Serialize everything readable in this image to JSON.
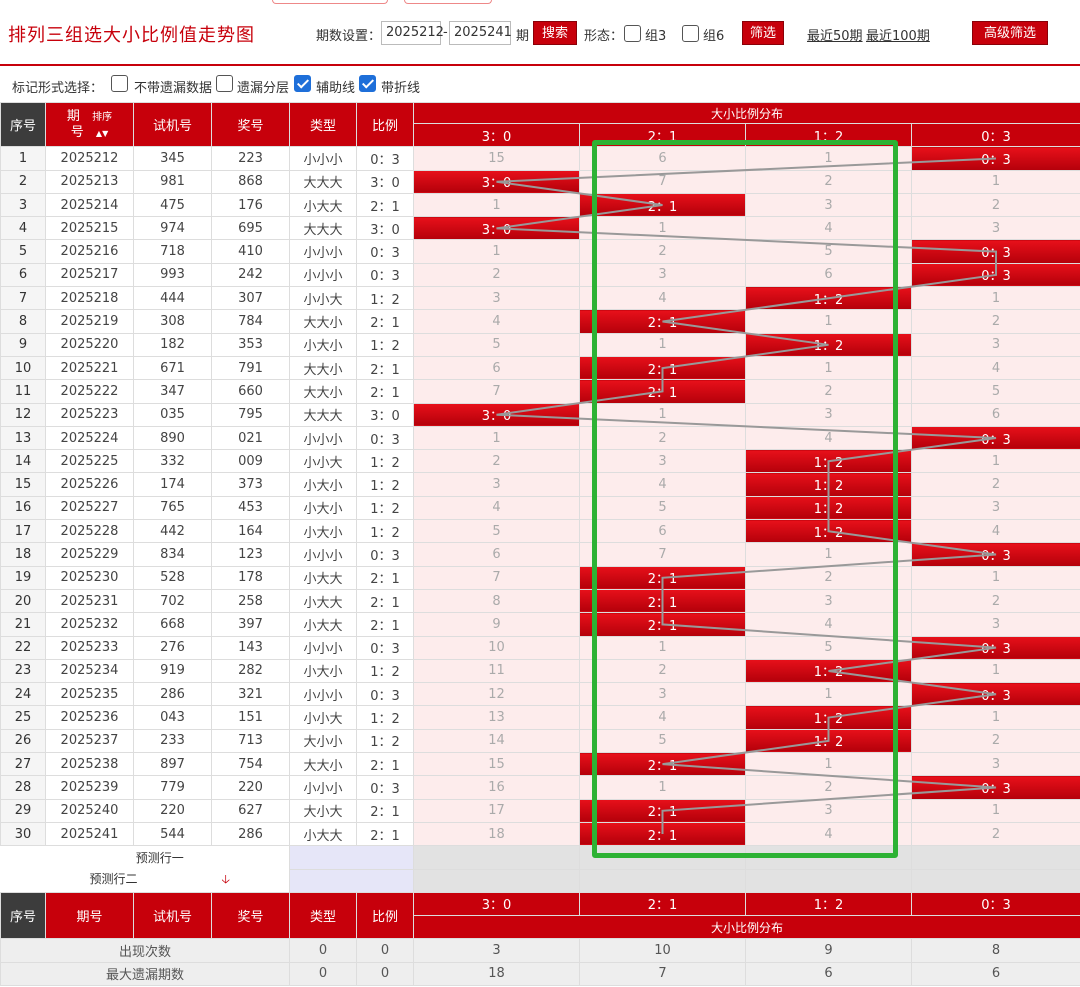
{
  "header": {
    "title": "排列三组选大小比例值走势图",
    "period_label": "期数设置：",
    "period_from": "2025212",
    "period_dash": "-",
    "period_to": "2025241",
    "period_unit": "期",
    "search": "搜索",
    "form_label": "形态：",
    "group3": "组3",
    "group6": "组6",
    "filter": "筛选",
    "recent50": "最近50期",
    "recent100": "最近100期",
    "advanced": "高级筛选"
  },
  "options": {
    "label": "标记形式选择：",
    "items": [
      {
        "label": "不带遗漏数据",
        "checked": false
      },
      {
        "label": "遗漏分层",
        "checked": false
      },
      {
        "label": "辅助线",
        "checked": true
      },
      {
        "label": "带折线",
        "checked": true
      }
    ]
  },
  "columns": {
    "seq": "序号",
    "issue_a": "期",
    "issue_b": "号",
    "sort": "排序",
    "trial": "试机号",
    "prize": "奖号",
    "type": "类型",
    "ratio": "比例",
    "dist": "大小比例分布",
    "dist_cols": [
      "3：0",
      "2：1",
      "1：2",
      "0：3"
    ]
  },
  "rows": [
    {
      "seq": "1",
      "issue": "2025212",
      "trial": "345",
      "prize": "223",
      "type": "小小小",
      "ratio": "0：3",
      "dist": [
        "15",
        "6",
        "1",
        "0：3"
      ],
      "hit": 3
    },
    {
      "seq": "2",
      "issue": "2025213",
      "trial": "981",
      "prize": "868",
      "type": "大大大",
      "ratio": "3：0",
      "dist": [
        "3：0",
        "7",
        "2",
        "1"
      ],
      "hit": 0
    },
    {
      "seq": "3",
      "issue": "2025214",
      "trial": "475",
      "prize": "176",
      "type": "小大大",
      "ratio": "2：1",
      "dist": [
        "1",
        "2：1",
        "3",
        "2"
      ],
      "hit": 1
    },
    {
      "seq": "4",
      "issue": "2025215",
      "trial": "974",
      "prize": "695",
      "type": "大大大",
      "ratio": "3：0",
      "dist": [
        "3：0",
        "1",
        "4",
        "3"
      ],
      "hit": 0
    },
    {
      "seq": "5",
      "issue": "2025216",
      "trial": "718",
      "prize": "410",
      "type": "小小小",
      "ratio": "0：3",
      "dist": [
        "1",
        "2",
        "5",
        "0：3"
      ],
      "hit": 3
    },
    {
      "seq": "6",
      "issue": "2025217",
      "trial": "993",
      "prize": "242",
      "type": "小小小",
      "ratio": "0：3",
      "dist": [
        "2",
        "3",
        "6",
        "0：3"
      ],
      "hit": 3
    },
    {
      "seq": "7",
      "issue": "2025218",
      "trial": "444",
      "prize": "307",
      "type": "小小大",
      "ratio": "1：2",
      "dist": [
        "3",
        "4",
        "1：2",
        "1"
      ],
      "hit": 2
    },
    {
      "seq": "8",
      "issue": "2025219",
      "trial": "308",
      "prize": "784",
      "type": "大大小",
      "ratio": "2：1",
      "dist": [
        "4",
        "2：1",
        "1",
        "2"
      ],
      "hit": 1
    },
    {
      "seq": "9",
      "issue": "2025220",
      "trial": "182",
      "prize": "353",
      "type": "小大小",
      "ratio": "1：2",
      "dist": [
        "5",
        "1",
        "1：2",
        "3"
      ],
      "hit": 2
    },
    {
      "seq": "10",
      "issue": "2025221",
      "trial": "671",
      "prize": "791",
      "type": "大大小",
      "ratio": "2：1",
      "dist": [
        "6",
        "2：1",
        "1",
        "4"
      ],
      "hit": 1
    },
    {
      "seq": "11",
      "issue": "2025222",
      "trial": "347",
      "prize": "660",
      "type": "大大小",
      "ratio": "2：1",
      "dist": [
        "7",
        "2：1",
        "2",
        "5"
      ],
      "hit": 1
    },
    {
      "seq": "12",
      "issue": "2025223",
      "trial": "035",
      "prize": "795",
      "type": "大大大",
      "ratio": "3：0",
      "dist": [
        "3：0",
        "1",
        "3",
        "6"
      ],
      "hit": 0
    },
    {
      "seq": "13",
      "issue": "2025224",
      "trial": "890",
      "prize": "021",
      "type": "小小小",
      "ratio": "0：3",
      "dist": [
        "1",
        "2",
        "4",
        "0：3"
      ],
      "hit": 3
    },
    {
      "seq": "14",
      "issue": "2025225",
      "trial": "332",
      "prize": "009",
      "type": "小小大",
      "ratio": "1：2",
      "dist": [
        "2",
        "3",
        "1：2",
        "1"
      ],
      "hit": 2
    },
    {
      "seq": "15",
      "issue": "2025226",
      "trial": "174",
      "prize": "373",
      "type": "小大小",
      "ratio": "1：2",
      "dist": [
        "3",
        "4",
        "1：2",
        "2"
      ],
      "hit": 2
    },
    {
      "seq": "16",
      "issue": "2025227",
      "trial": "765",
      "prize": "453",
      "type": "小大小",
      "ratio": "1：2",
      "dist": [
        "4",
        "5",
        "1：2",
        "3"
      ],
      "hit": 2
    },
    {
      "seq": "17",
      "issue": "2025228",
      "trial": "442",
      "prize": "164",
      "type": "小大小",
      "ratio": "1：2",
      "dist": [
        "5",
        "6",
        "1：2",
        "4"
      ],
      "hit": 2
    },
    {
      "seq": "18",
      "issue": "2025229",
      "trial": "834",
      "prize": "123",
      "type": "小小小",
      "ratio": "0：3",
      "dist": [
        "6",
        "7",
        "1",
        "0：3"
      ],
      "hit": 3
    },
    {
      "seq": "19",
      "issue": "2025230",
      "trial": "528",
      "prize": "178",
      "type": "小大大",
      "ratio": "2：1",
      "dist": [
        "7",
        "2：1",
        "2",
        "1"
      ],
      "hit": 1
    },
    {
      "seq": "20",
      "issue": "2025231",
      "trial": "702",
      "prize": "258",
      "type": "小大大",
      "ratio": "2：1",
      "dist": [
        "8",
        "2：1",
        "3",
        "2"
      ],
      "hit": 1
    },
    {
      "seq": "21",
      "issue": "2025232",
      "trial": "668",
      "prize": "397",
      "type": "小大大",
      "ratio": "2：1",
      "dist": [
        "9",
        "2：1",
        "4",
        "3"
      ],
      "hit": 1
    },
    {
      "seq": "22",
      "issue": "2025233",
      "trial": "276",
      "prize": "143",
      "type": "小小小",
      "ratio": "0：3",
      "dist": [
        "10",
        "1",
        "5",
        "0：3"
      ],
      "hit": 3
    },
    {
      "seq": "23",
      "issue": "2025234",
      "trial": "919",
      "prize": "282",
      "type": "小大小",
      "ratio": "1：2",
      "dist": [
        "11",
        "2",
        "1：2",
        "1"
      ],
      "hit": 2
    },
    {
      "seq": "24",
      "issue": "2025235",
      "trial": "286",
      "prize": "321",
      "type": "小小小",
      "ratio": "0：3",
      "dist": [
        "12",
        "3",
        "1",
        "0：3"
      ],
      "hit": 3
    },
    {
      "seq": "25",
      "issue": "2025236",
      "trial": "043",
      "prize": "151",
      "type": "小小大",
      "ratio": "1：2",
      "dist": [
        "13",
        "4",
        "1：2",
        "1"
      ],
      "hit": 2
    },
    {
      "seq": "26",
      "issue": "2025237",
      "trial": "233",
      "prize": "713",
      "type": "大小小",
      "ratio": "1：2",
      "dist": [
        "14",
        "5",
        "1：2",
        "2"
      ],
      "hit": 2
    },
    {
      "seq": "27",
      "issue": "2025238",
      "trial": "897",
      "prize": "754",
      "type": "大大小",
      "ratio": "2：1",
      "dist": [
        "15",
        "2：1",
        "1",
        "3"
      ],
      "hit": 1
    },
    {
      "seq": "28",
      "issue": "2025239",
      "trial": "779",
      "prize": "220",
      "type": "小小小",
      "ratio": "0：3",
      "dist": [
        "16",
        "1",
        "2",
        "0：3"
      ],
      "hit": 3
    },
    {
      "seq": "29",
      "issue": "2025240",
      "trial": "220",
      "prize": "627",
      "type": "大小大",
      "ratio": "2：1",
      "dist": [
        "17",
        "2：1",
        "3",
        "1"
      ],
      "hit": 1
    },
    {
      "seq": "30",
      "issue": "2025241",
      "trial": "544",
      "prize": "286",
      "type": "小大大",
      "ratio": "2：1",
      "dist": [
        "18",
        "2：1",
        "4",
        "2"
      ],
      "hit": 1
    }
  ],
  "predict": {
    "row1": "预测行一",
    "row2": "预测行二"
  },
  "stats": [
    {
      "label": "出现次数",
      "type": "0",
      "ratio": "0",
      "vals": [
        "3",
        "10",
        "9",
        "8"
      ]
    },
    {
      "label": "最大遗漏期数",
      "type": "0",
      "ratio": "0",
      "vals": [
        "18",
        "7",
        "6",
        "6"
      ]
    }
  ],
  "colors": {
    "accent": "#c7000b",
    "highlight_box": "#2db234",
    "check": "#1e6fd9"
  }
}
